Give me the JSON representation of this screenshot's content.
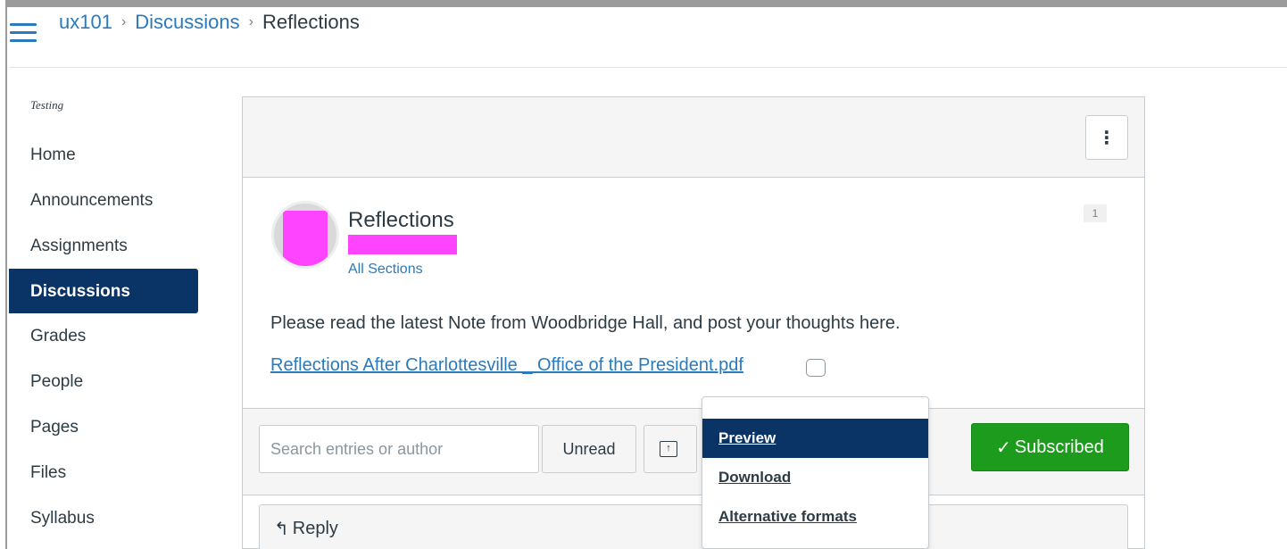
{
  "breadcrumb": {
    "course": "ux101",
    "section": "Discussions",
    "current": "Reflections",
    "separator": "›"
  },
  "sidebar": {
    "course_label": "Testing",
    "items": [
      {
        "label": "Home"
      },
      {
        "label": "Announcements"
      },
      {
        "label": "Assignments"
      },
      {
        "label": "Discussions",
        "active": true
      },
      {
        "label": "Grades"
      },
      {
        "label": "People"
      },
      {
        "label": "Pages"
      },
      {
        "label": "Files"
      },
      {
        "label": "Syllabus"
      }
    ]
  },
  "topic": {
    "title": "Reflections",
    "sections_link": "All Sections",
    "badge_count": "1",
    "message": "Please read the latest Note from Woodbridge Hall, and post your thoughts here.",
    "attachment": "Reflections After Charlottesville _ Office of the President.pdf"
  },
  "header_menu": {
    "icon": "kebab-icon",
    "label": "⋮"
  },
  "toolbar": {
    "search_placeholder": "Search entries or author",
    "unread_label": "Unread",
    "collapse_icon": "↑",
    "subscribed_label": "Subscribed",
    "subscribed_icon": "✓"
  },
  "reply": {
    "label": "Reply",
    "icon": "↰"
  },
  "attachment_menu": {
    "items": [
      {
        "label": "Preview",
        "active": true
      },
      {
        "label": "Download"
      },
      {
        "label": "Alternative formats"
      }
    ]
  },
  "colors": {
    "link": "#2b7abc",
    "nav_active": "#0b3466",
    "subscribed": "#1d9b1d",
    "redaction": "#ff44ff"
  }
}
